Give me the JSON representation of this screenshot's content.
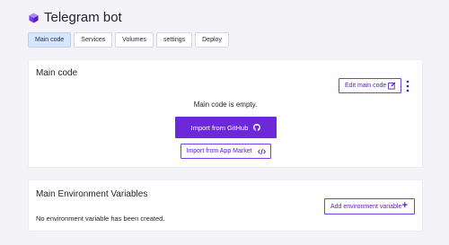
{
  "header": {
    "title": "Telegram bot",
    "icon": "cube-icon",
    "tabs": [
      {
        "label": "Main code",
        "active": true
      },
      {
        "label": "Services",
        "active": false
      },
      {
        "label": "Volumes",
        "active": false
      },
      {
        "label": "settings",
        "active": false
      },
      {
        "label": "Deploy",
        "active": false
      }
    ]
  },
  "main_code": {
    "title": "Main code",
    "edit_label": "Edit main code",
    "empty_message": "Main code is empty.",
    "import_github_label": "Import from GitHub",
    "import_app_market_label": "Import from App Market"
  },
  "env_vars": {
    "title": "Main Environment Variables",
    "add_label": "Add environment variable",
    "empty_message": "No environment variable has been created."
  },
  "colors": {
    "accent": "#6d28d9",
    "active_tab": "#d6e6fb",
    "background": "#f3f3f8"
  }
}
